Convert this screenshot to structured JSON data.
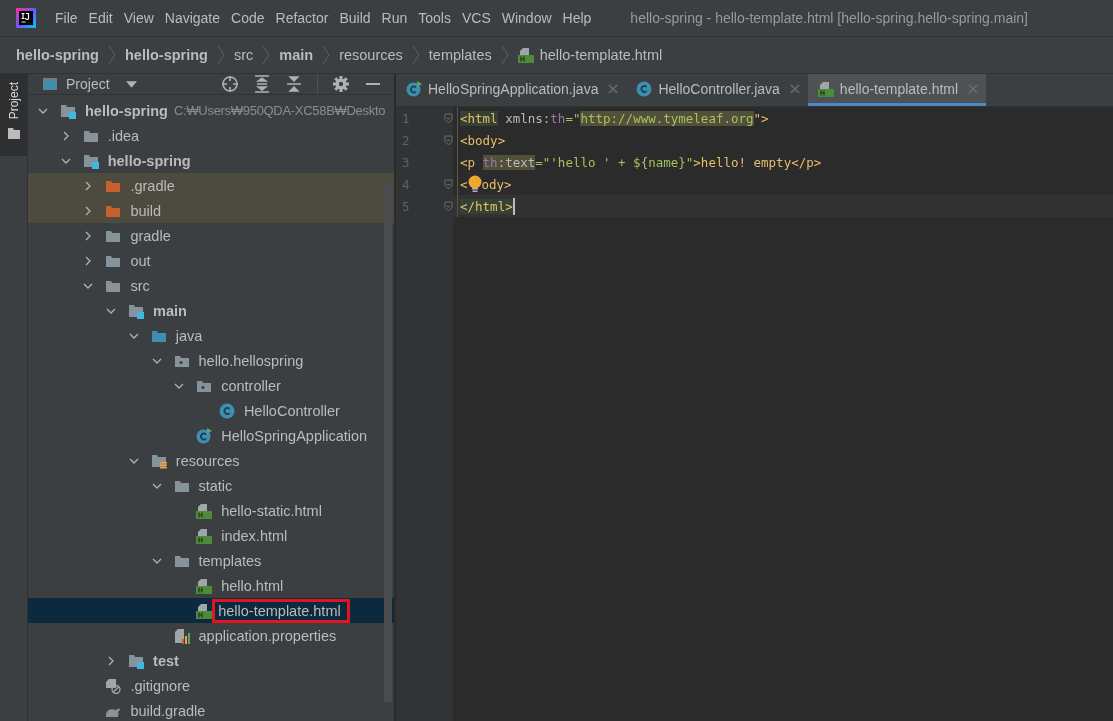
{
  "menu": [
    "File",
    "Edit",
    "View",
    "Navigate",
    "Code",
    "Refactor",
    "Build",
    "Run",
    "Tools",
    "VCS",
    "Window",
    "Help"
  ],
  "window": {
    "title": "hello-spring - hello-template.html [hello-spring.hello-spring.main]"
  },
  "breadcrumbs": [
    {
      "label": "hello-spring",
      "bold": true
    },
    {
      "label": "hello-spring",
      "bold": true
    },
    {
      "label": "src",
      "bold": false
    },
    {
      "label": "main",
      "bold": true
    },
    {
      "label": "resources",
      "bold": false
    },
    {
      "label": "templates",
      "bold": false
    },
    {
      "label": "hello-template.html",
      "bold": false,
      "kind": "html"
    }
  ],
  "side_tab": "Project",
  "project_panel": {
    "title": "Project",
    "tree": [
      {
        "label": "hello-spring",
        "kind": "module",
        "path": "C:₩Users₩950QDA-XC58B₩Deskto",
        "expanded": true,
        "selected": false,
        "children": [
          {
            "label": ".idea",
            "kind": "folder",
            "expanded": false,
            "selected": false
          },
          {
            "label": "hello-spring",
            "kind": "module",
            "expanded": true,
            "selected": false,
            "children": [
              {
                "label": ".gradle",
                "kind": "excluded",
                "expanded": false,
                "selected": false
              },
              {
                "label": "build",
                "kind": "excluded",
                "expanded": false,
                "selected": false
              },
              {
                "label": "gradle",
                "kind": "folder",
                "expanded": false,
                "selected": false
              },
              {
                "label": "out",
                "kind": "folder",
                "expanded": false,
                "selected": false
              },
              {
                "label": "src",
                "kind": "folder",
                "expanded": true,
                "selected": false,
                "children": [
                  {
                    "label": "main",
                    "kind": "module",
                    "expanded": true,
                    "selected": false,
                    "children": [
                      {
                        "label": "java",
                        "kind": "source",
                        "expanded": true,
                        "selected": false,
                        "children": [
                          {
                            "label": "hello.hellospring",
                            "kind": "package",
                            "expanded": true,
                            "selected": false,
                            "children": [
                              {
                                "label": "controller",
                                "kind": "package",
                                "expanded": true,
                                "selected": false,
                                "children": [
                                  {
                                    "label": "HelloController",
                                    "kind": "class",
                                    "selected": false
                                  }
                                ]
                              },
                              {
                                "label": "HelloSpringApplication",
                                "kind": "app",
                                "selected": false
                              }
                            ]
                          }
                        ]
                      },
                      {
                        "label": "resources",
                        "kind": "resources",
                        "expanded": true,
                        "selected": false,
                        "children": [
                          {
                            "label": "static",
                            "kind": "folder",
                            "expanded": true,
                            "selected": false,
                            "children": [
                              {
                                "label": "hello-static.html",
                                "kind": "html",
                                "selected": false
                              },
                              {
                                "label": "index.html",
                                "kind": "html",
                                "selected": false
                              }
                            ]
                          },
                          {
                            "label": "templates",
                            "kind": "folder",
                            "expanded": true,
                            "selected": false,
                            "children": [
                              {
                                "label": "hello.html",
                                "kind": "html",
                                "selected": false
                              },
                              {
                                "label": "hello-template.html",
                                "kind": "html",
                                "selected": true,
                                "boxed": true
                              }
                            ]
                          },
                          {
                            "label": "application.properties",
                            "kind": "properties",
                            "selected": false
                          }
                        ]
                      }
                    ]
                  },
                  {
                    "label": "test",
                    "kind": "module",
                    "expanded": false,
                    "selected": false
                  }
                ]
              },
              {
                "label": ".gitignore",
                "kind": "gitignore",
                "selected": false
              },
              {
                "label": "build.gradle",
                "kind": "gradle",
                "selected": false
              }
            ]
          }
        ]
      }
    ]
  },
  "tabs": [
    {
      "label": "HelloSpringApplication.java",
      "kind": "app",
      "selected": false
    },
    {
      "label": "HelloController.java",
      "kind": "class",
      "selected": false
    },
    {
      "label": "hello-template.html",
      "kind": "html",
      "selected": true
    }
  ],
  "editor": {
    "lines": [
      {
        "number": "1",
        "fold": true,
        "current": false,
        "segments": [
          {
            "text": "<html",
            "kind": "tag",
            "highlighted": true
          },
          {
            "text": " xmlns:",
            "kind": "attr"
          },
          {
            "text": "th",
            "kind": "ns"
          },
          {
            "text": "=\"",
            "kind": "string"
          },
          {
            "text": "http://www.tymeleaf.org",
            "kind": "string",
            "highlighted": true
          },
          {
            "text": "\">",
            "kind": "tag"
          }
        ]
      },
      {
        "number": "2",
        "fold": true,
        "current": false,
        "segments": [
          {
            "text": "<body>",
            "kind": "tag"
          }
        ]
      },
      {
        "number": "3",
        "fold": false,
        "current": false,
        "segments": [
          {
            "text": "<p ",
            "kind": "tag"
          },
          {
            "text": "th",
            "kind": "ns",
            "highlighted": true
          },
          {
            "text": ":text",
            "kind": "attr",
            "highlighted": true
          },
          {
            "text": "=\"'hello ' + ${name}\"",
            "kind": "string"
          },
          {
            "text": ">hello! empty</p>",
            "kind": "tag"
          }
        ]
      },
      {
        "number": "4",
        "fold": true,
        "current": false,
        "segments": [
          {
            "text": "<",
            "kind": "tag"
          },
          {
            "kind": "bulb"
          },
          {
            "text": "ody>",
            "kind": "tag"
          }
        ]
      },
      {
        "number": "5",
        "fold": true,
        "current": true,
        "segments": [
          {
            "text": "</html>",
            "kind": "tag",
            "highlighted": true
          }
        ]
      }
    ]
  }
}
